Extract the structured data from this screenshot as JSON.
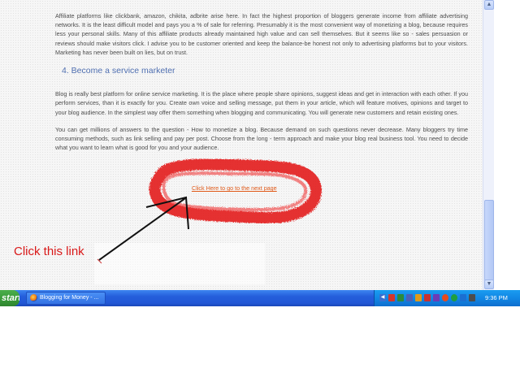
{
  "article": {
    "paragraph_1": "Affiliate platforms like clickbank, amazon, chikita, adbrite arise here. In fact the highest proportion of bloggers generate income from affiliate advertising networks. It is the least difficult model and pays you a % of sale for referring. Presumably it is the most convenient way of monetizing a blog, because requires less your personal skills. Many of this affiliate products already maintained high value and can sell themselves. But it seems like so - sales persuasion or reviews should make visitors click. I advise you to be customer oriented and keep the balance-be honest not only to advertising platforms but to your visitors. Marketing has never been built on lies, but on trust.",
    "heading_4": "4. Become a service marketer",
    "paragraph_2": "Blog is really best platform for online service marketing. It is the place where people share opinions, suggest ideas and get in interaction with each other. If you perform services, than it is exactly for you. Create own voice and selling message, put them in your article, which will feature motives, opinions and target to your blog audience. In the simplest way offer them something when blogging and communicating. You will generate new customers and retain existing ones.",
    "paragraph_3": "You can get millions of answers to the question - How to monetize a blog. Because demand on such questions never decrease. Many bloggers try time consuming methods, such as link selling and pay per post. Choose from the long - term approach and make your blog real business tool. You need to decide what you want to learn what is good for you and your audience.",
    "next_link": "Click Here to go to the next page"
  },
  "annotation": {
    "label": "Click this link",
    "color": "#d91818"
  },
  "scrollbar": {
    "up_glyph": "▲",
    "down_glyph": "▼"
  },
  "taskbar": {
    "start_label": "start",
    "task_item": "Blogging for Money - ...",
    "clock": "9:36 PM",
    "tray_icons": [
      "network-icon",
      "flag-icon",
      "shield-icon",
      "speaker-icon",
      "messenger-icon",
      "antivirus-icon",
      "update-icon",
      "chat-icon",
      "skype-icon",
      "volume-icon"
    ]
  }
}
